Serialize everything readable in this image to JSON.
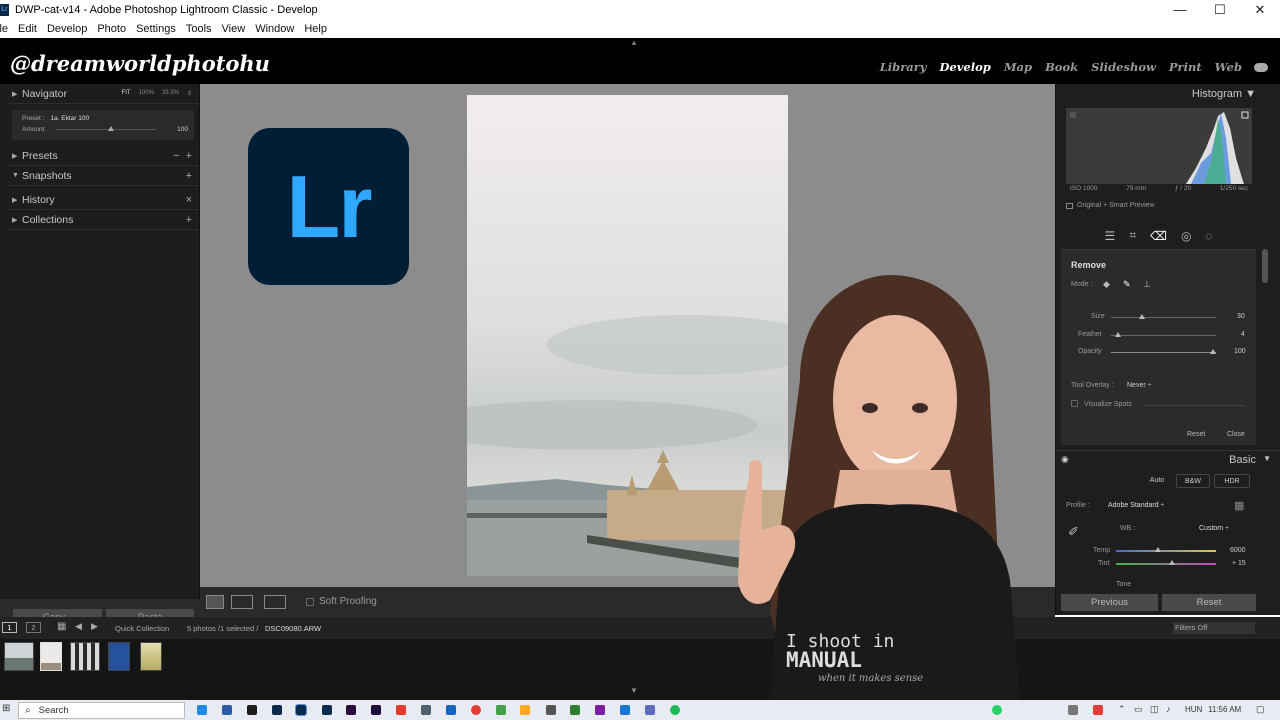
{
  "window": {
    "title": "DWP-cat-v14 - Adobe Photoshop Lightroom Classic - Develop",
    "controls": {
      "minimize": "—",
      "maximize": "☐",
      "close": "✕"
    }
  },
  "menu": [
    "ile",
    "Edit",
    "Develop",
    "Photo",
    "Settings",
    "Tools",
    "View",
    "Window",
    "Help"
  ],
  "identity_plate": "@dreamworldphotohu",
  "modules": [
    "Library",
    "Develop",
    "Map",
    "Book",
    "Slideshow",
    "Print",
    "Web"
  ],
  "active_module": "Develop",
  "left_panel": {
    "navigator": {
      "label": "Navigator",
      "fit": "FIT",
      "zoom1": "100%",
      "zoom2": "33.3%"
    },
    "preset_box": {
      "preset_label": "Preset :",
      "preset_value": "1a. Ektar 100",
      "amount_label": "Amount",
      "amount_value": "100"
    },
    "presets": "Presets",
    "snapshots": "Snapshots",
    "history": "History",
    "collections": "Collections",
    "copy": "Copy...",
    "paste": "Paste"
  },
  "center": {
    "logo_text": "Lr",
    "soft_proofing": "Soft Proofing"
  },
  "right_panel": {
    "histogram": "Histogram",
    "iso": "ISO 1000",
    "focal": "79 mm",
    "aperture": "ƒ / 20",
    "shutter": "1/250 sec",
    "original": "Original + Smart Preview",
    "remove": {
      "title": "Remove",
      "mode": "Mode :",
      "size_label": "Size",
      "size_value": "30",
      "feather_label": "Feather",
      "feather_value": "4",
      "opacity_label": "Opacity",
      "opacity_value": "100",
      "tool_overlay_label": "Tool Overlay :",
      "tool_overlay_value": "Never ÷",
      "visualize": "Visualize Spots",
      "reset": "Reset",
      "close": "Close"
    },
    "basic": {
      "title": "Basic",
      "auto": "Auto",
      "bw": "B&W",
      "hdr": "HDR",
      "profile_label": "Profile :",
      "profile_value": "Adobe Standard ÷",
      "wb_label": "WB :",
      "wb_value": "Custom ÷",
      "temp_label": "Temp",
      "temp_value": "6000",
      "tint_label": "Tint",
      "tint_value": "+ 15",
      "tone": "Tone"
    },
    "previous": "Previous",
    "reset": "Reset"
  },
  "filmstrip": {
    "screen1": "1",
    "screen2": "2",
    "source": "Quick Collection",
    "info": "5 photos /1 selected /",
    "filename": "DSC09080.ARW",
    "filters": "Filters Off"
  },
  "taskbar": {
    "search": "Search",
    "lang": "HUN",
    "time": "11:56 AM"
  },
  "shirt": {
    "line1": "I shoot in",
    "line2": "MANUAL",
    "line3": "when it makes sense"
  },
  "colors": {
    "panel": "#1d1d1d",
    "canvas": "#8c8c8c",
    "lr_blue": "#31a8ff",
    "lr_bg": "#001e36"
  }
}
